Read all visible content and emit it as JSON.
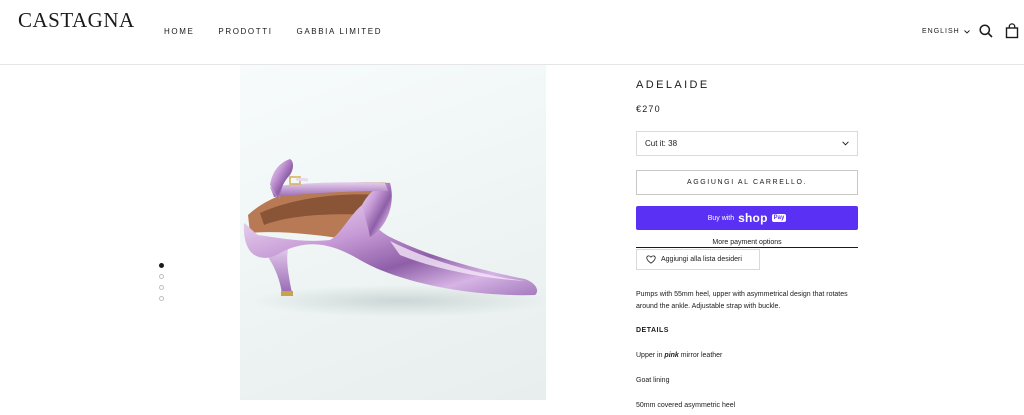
{
  "header": {
    "logo": "CASTAGNA",
    "nav": [
      "HOME",
      "PRODOTTI",
      "GABBIA LIMITED"
    ],
    "language": "ENGLISH",
    "icons": [
      "search-icon",
      "bag-icon",
      "chevron-down-icon"
    ]
  },
  "gallery": {
    "image_alt": "Adelaide lilac mirror leather kitten-heel slingback pump",
    "dot_count": 4,
    "active_dot": 1
  },
  "product": {
    "title": "ADELAIDE",
    "price": "€270",
    "size_select": "Cut it: 38",
    "add_to_cart": "AGGIUNGI AL CARRELLO.",
    "shop_pay": {
      "buy_with": "Buy with",
      "brand": "shop",
      "pay": "Pay"
    },
    "more_payment": "More payment options",
    "wishlist": "Aggiungi alla lista desideri",
    "description": "Pumps with 55mm heel, upper with asymmetrical design that rotates around the ankle. Adjustable strap with buckle.",
    "details_heading": "DETAILS",
    "detail_1_prefix": "Upper in",
    "detail_1_emph": "pink",
    "detail_1_suffix": "mirror leather",
    "detail_2": "Goat lining",
    "detail_3": "50mm covered asymmetric heel"
  },
  "colors": {
    "text": "#1c1b1b",
    "shop_pay": "#5a31f4",
    "border": "#d9d9d9"
  }
}
